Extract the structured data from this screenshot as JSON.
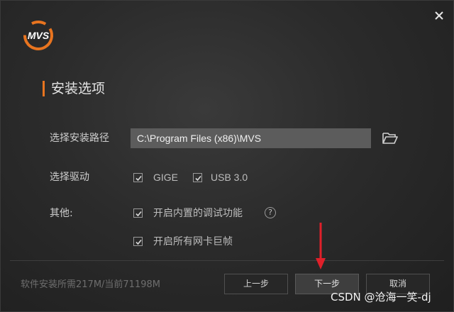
{
  "window": {
    "close_icon": "close-icon",
    "logo_text": "MVS"
  },
  "section": {
    "title": "安装选项"
  },
  "install_path": {
    "label": "选择安装路径",
    "value": "C:\\Program Files (x86)\\MVS",
    "browse_icon": "folder-open-icon"
  },
  "drivers": {
    "label": "选择驱动",
    "options": [
      {
        "label": "GIGE",
        "checked": true
      },
      {
        "label": "USB 3.0",
        "checked": true
      }
    ]
  },
  "other": {
    "label": "其他:",
    "options": [
      {
        "label": "开启内置的调试功能",
        "checked": true,
        "help": "?"
      },
      {
        "label": "开启所有网卡巨帧",
        "checked": true
      }
    ]
  },
  "footer": {
    "info": "软件安装所需217M/当前71198M",
    "prev_label": "上一步",
    "next_label": "下一步",
    "cancel_label": "取消"
  },
  "annotation": {
    "arrow_color": "#e0202a",
    "watermark": "CSDN @沧海一笑-dj"
  },
  "colors": {
    "accent": "#e8741f",
    "background": "#2b2b2b",
    "input_bg": "#5c5c5c"
  }
}
